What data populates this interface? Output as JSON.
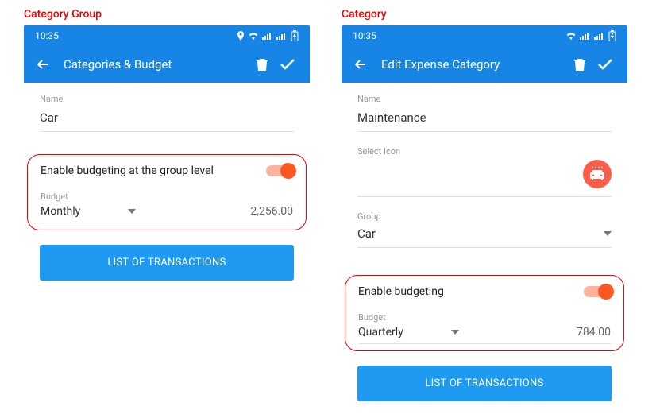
{
  "leftLabel": "Category Group",
  "rightLabel": "Category",
  "status": {
    "time": "10:35"
  },
  "left": {
    "title": "Categories & Budget",
    "nameLabel": "Name",
    "nameValue": "Car",
    "toggleLabel": "Enable budgeting at the group level",
    "budgetLabel": "Budget",
    "period": "Monthly",
    "amount": "2,256.00",
    "listBtn": "LIST OF TRANSACTIONS"
  },
  "right": {
    "title": "Edit Expense Category",
    "nameLabel": "Name",
    "nameValue": "Maintenance",
    "selectIconLabel": "Select Icon",
    "iconName": "car-wash-icon",
    "groupLabel": "Group",
    "groupValue": "Car",
    "toggleLabel": "Enable budgeting",
    "budgetLabel": "Budget",
    "period": "Quarterly",
    "amount": "784.00",
    "listBtn": "LIST OF TRANSACTIONS"
  },
  "colors": {
    "primary": "#1785e5",
    "accent": "#ff5722",
    "highlight": "#e00"
  }
}
